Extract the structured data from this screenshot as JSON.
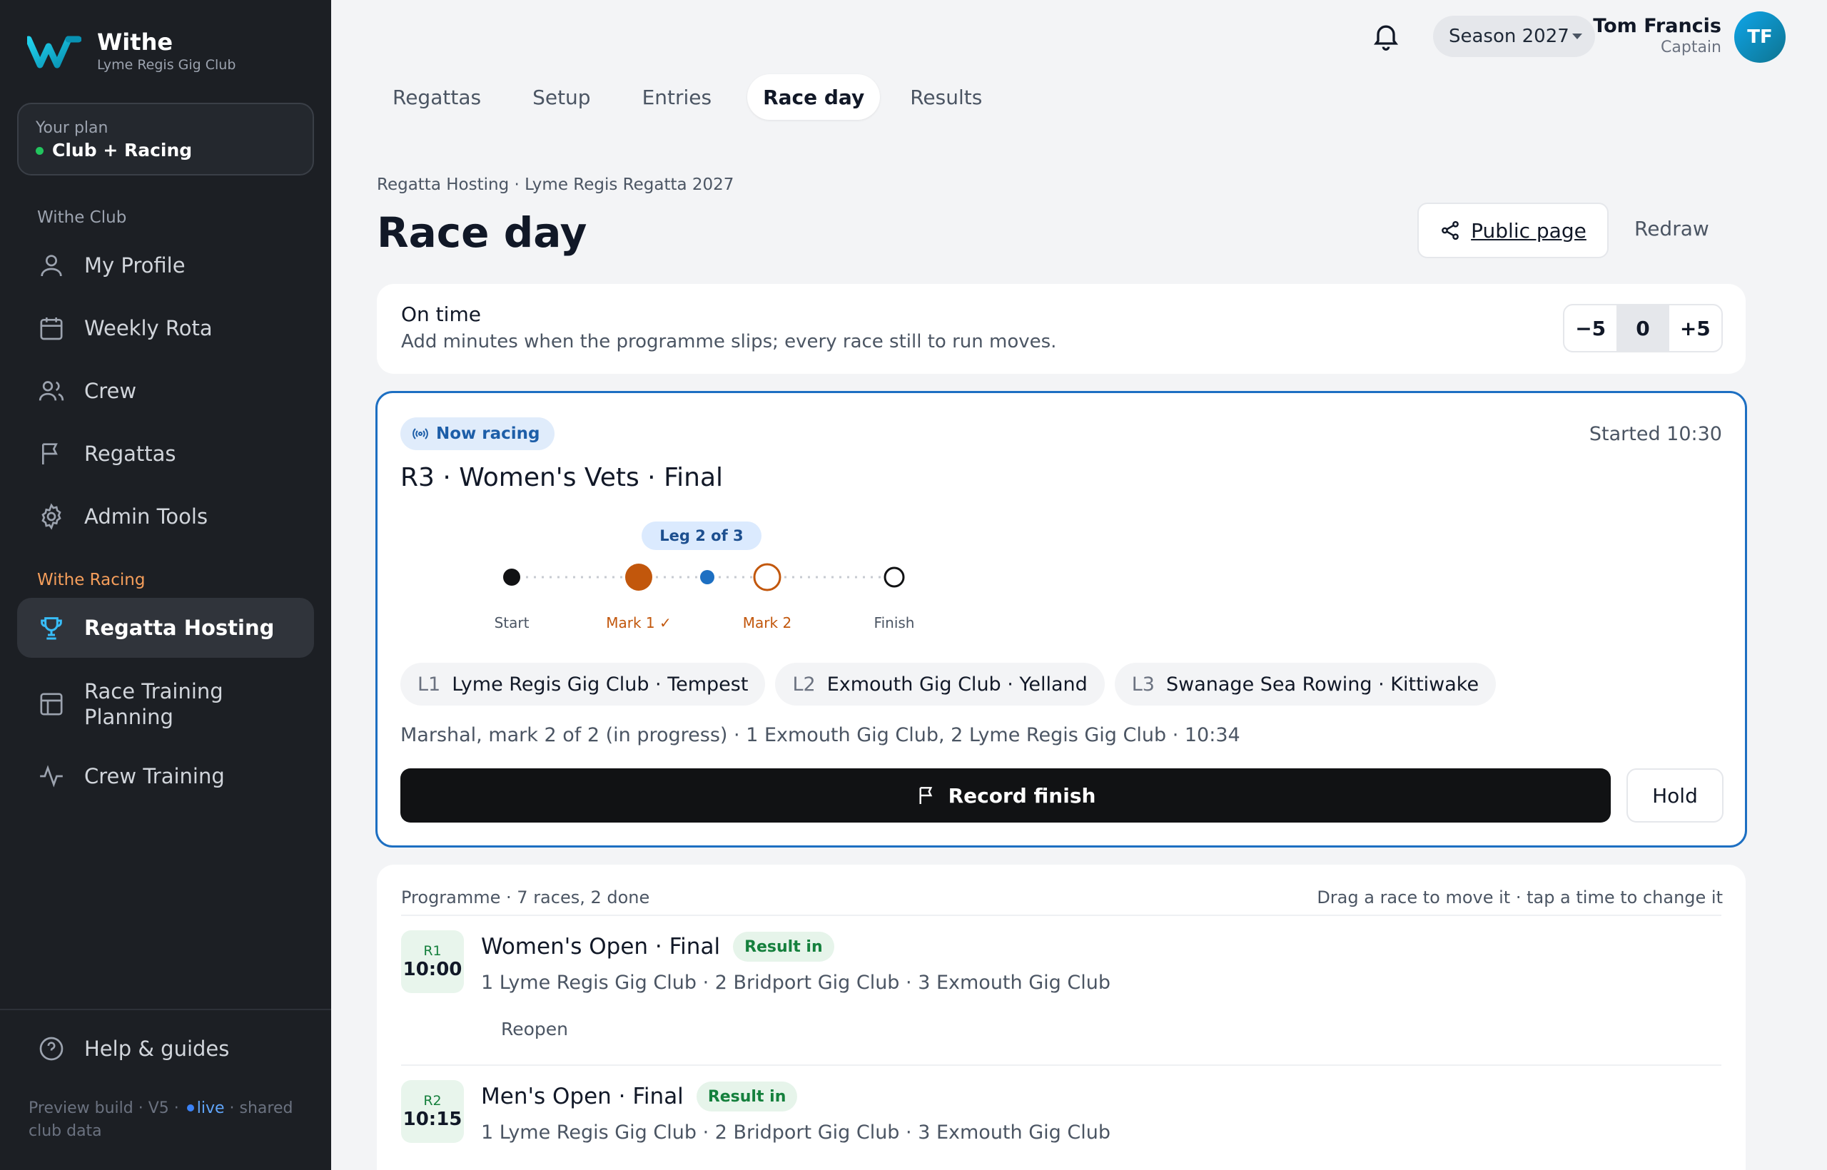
{
  "brand": {
    "name": "Withe",
    "club": "Lyme Regis Gig Club"
  },
  "plan": {
    "label": "Your plan",
    "value": "Club + Racing"
  },
  "sidebar": {
    "section_club": "Withe Club",
    "section_racing": "Withe Racing",
    "items": [
      {
        "label": "My Profile",
        "icon": "user-icon"
      },
      {
        "label": "Weekly Rota",
        "icon": "calendar-icon"
      },
      {
        "label": "Crew",
        "icon": "users-icon"
      },
      {
        "label": "Regattas",
        "icon": "flag-icon"
      },
      {
        "label": "Admin Tools",
        "icon": "gear-icon"
      },
      {
        "label": "Regatta Hosting",
        "icon": "trophy-icon"
      },
      {
        "label": "Race Training Planning",
        "icon": "layout-icon"
      },
      {
        "label": "Crew Training",
        "icon": "activity-icon"
      }
    ],
    "help": "Help & guides",
    "footer": {
      "prefix": "Preview build · V5 · ",
      "live": "live",
      "suffix": " · shared club data"
    }
  },
  "topbar": {
    "season": "Season 2027",
    "user_name": "Tom Francis",
    "user_role": "Captain",
    "avatar_initials": "TF"
  },
  "tabs": [
    "Regattas",
    "Setup",
    "Entries",
    "Race day",
    "Results"
  ],
  "active_tab": "Race day",
  "page": {
    "breadcrumb": "Regatta Hosting · Lyme Regis Regatta 2027",
    "title": "Race day",
    "public_page": "Public page",
    "redraw": "Redraw"
  },
  "ontime": {
    "title": "On time",
    "subtitle": "Add minutes when the programme slips; every race still to run moves.",
    "minus": "−5",
    "value": "0",
    "plus": "+5"
  },
  "now_racing": {
    "badge": "Now racing",
    "started": "Started 10:30",
    "title": "R3 · Women's Vets · Final",
    "leg": "Leg 2 of 3",
    "marks": [
      "Start",
      "Mark 1 ✓",
      "Mark 2",
      "Finish"
    ],
    "lanes": [
      {
        "lane": "L1",
        "crew": "Lyme Regis Gig Club · Tempest"
      },
      {
        "lane": "L2",
        "crew": "Exmouth Gig Club · Yelland"
      },
      {
        "lane": "L3",
        "crew": "Swanage Sea Rowing · Kittiwake"
      }
    ],
    "marshal": "Marshal, mark 2 of 2 (in progress) · 1 Exmouth Gig Club, 2 Lyme Regis Gig Club · 10:34",
    "record_finish": "Record finish",
    "hold": "Hold"
  },
  "programme": {
    "header": "Programme · 7 races, 2 done",
    "hint": "Drag a race to move it · tap a time to change it",
    "races": [
      {
        "num": "R1",
        "time": "10:00",
        "title": "Women's Open · Final",
        "badge": "Result in",
        "result": "1 Lyme Regis Gig Club · 2 Bridport Gig Club · 3 Exmouth Gig Club",
        "action": "Reopen"
      },
      {
        "num": "R2",
        "time": "10:15",
        "title": "Men's Open · Final",
        "badge": "Result in",
        "result": "1 Lyme Regis Gig Club · 2 Bridport Gig Club · 3 Exmouth Gig Club"
      }
    ]
  },
  "colors": {
    "accent": "#1d6fc2",
    "mark_orange": "#c2570c",
    "sidebar_bg": "#1c1f24",
    "racing_section": "#f59e5b"
  }
}
